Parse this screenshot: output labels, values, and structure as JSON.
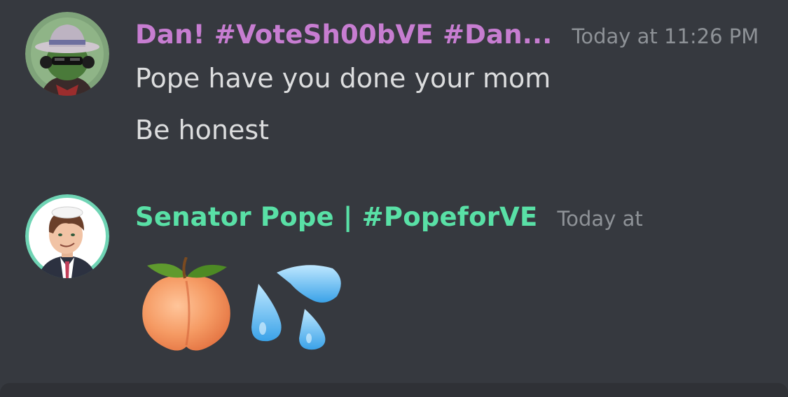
{
  "messages": [
    {
      "username": "Dan! #VoteSh00bVE #Dan...",
      "username_color": "#c77dd1",
      "timestamp": "Today at 11:26 PM",
      "lines": [
        "Pope have you done your mom",
        "Be honest"
      ],
      "avatar_icon": "fedora-sunglasses-avatar"
    },
    {
      "username": "Senator Pope | #PopeforVE",
      "username_color": "#59e0a6",
      "timestamp": "Today at",
      "emojis": [
        "peach-emoji",
        "sweat-droplets-emoji"
      ],
      "avatar_icon": "suited-man-avatar"
    }
  ],
  "colors": {
    "background": "#36393f",
    "composer": "#2f3136",
    "text": "#dcddde",
    "timestamp": "#8e9297"
  }
}
